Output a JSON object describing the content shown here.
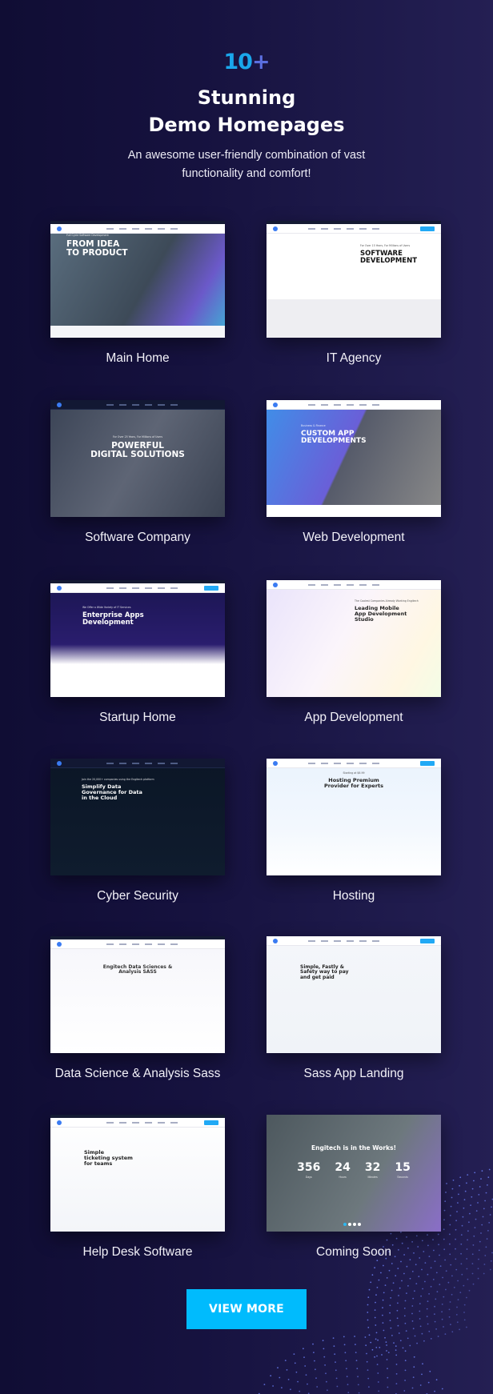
{
  "hero": {
    "count_number": "10",
    "count_suffix": "+",
    "title_line1": "Stunning",
    "title_line2": "Demo Homepages",
    "subtitle_line1": "An awesome user-friendly combination of vast",
    "subtitle_line2": "functionality and comfort!"
  },
  "colors": {
    "background_start": "#100d34",
    "background_end": "#241f53",
    "count_number": "#1aa7ec",
    "count_suffix": "#5b6fe0",
    "button": "#00bbfd"
  },
  "demos": [
    {
      "label": "Main Home",
      "headline": "FROM IDEA\nTO PRODUCT",
      "kicker": "Full Cycle Software Development"
    },
    {
      "label": "IT Agency",
      "headline": "SOFTWARE\nDEVELOPMENT",
      "kicker": "For Over 15 Years, For Millions of Users"
    },
    {
      "label": "Software Company",
      "headline": "POWERFUL\nDIGITAL SOLUTIONS",
      "kicker": "For Over 25 Years, For Millions of Users"
    },
    {
      "label": "Web Development",
      "headline": "CUSTOM APP\nDEVELOPMENTS",
      "kicker": "Business & Finance"
    },
    {
      "label": "Startup Home",
      "headline": "Enterprise Apps\nDevelopment",
      "kicker": "We Offer a Wide Variety of IT Services"
    },
    {
      "label": "App Development",
      "headline": "Leading Mobile\nApp Development\nStudio",
      "kicker": "The Coolest Companies Already Working Engitech"
    },
    {
      "label": "Cyber Security",
      "headline": "Simplify Data\nGovernance for Data\nin the Cloud",
      "kicker": "Join the 20,000+ companies using the Engitech platform"
    },
    {
      "label": "Hosting",
      "headline": "Hosting Premium\nProvider for Experts",
      "kicker": "Starting at $6.99"
    },
    {
      "label": "Data Science & Analysis Sass",
      "headline": "Engitech Data Sciences &\nAnalysis SASS",
      "kicker": ""
    },
    {
      "label": "Sass App Landing",
      "headline": "Simple, Fastly &\nSafety way to pay\nand get paid",
      "kicker": ""
    },
    {
      "label": "Help Desk Software",
      "headline": "Simple\nticketing system\nfor teams",
      "kicker": ""
    },
    {
      "label": "Coming Soon",
      "headline": "Engitech is in the Works!",
      "kicker": "",
      "countdown": [
        {
          "value": "356",
          "unit": "Days"
        },
        {
          "value": "24",
          "unit": "Hours"
        },
        {
          "value": "32",
          "unit": "Minutes"
        },
        {
          "value": "15",
          "unit": "Seconds"
        }
      ]
    }
  ],
  "cta": {
    "view_more_label": "VIEW MORE"
  }
}
